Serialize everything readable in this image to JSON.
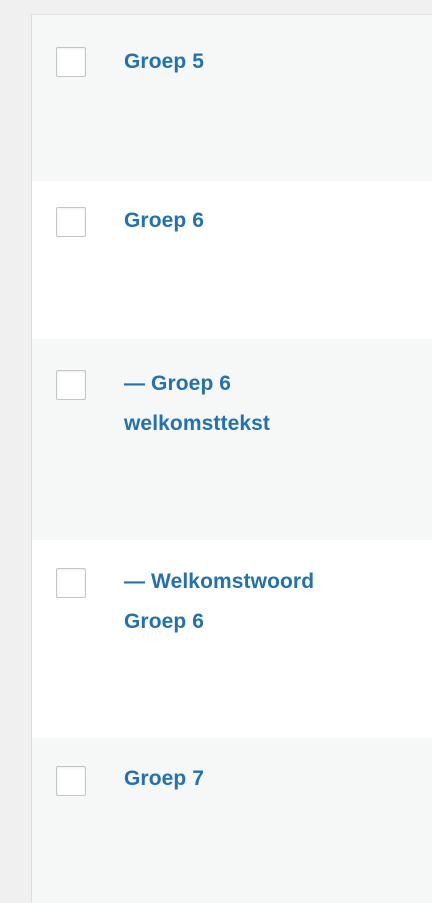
{
  "rows": [
    {
      "checkbox_checked": false,
      "title_lines": [
        "Groep 5"
      ]
    },
    {
      "checkbox_checked": false,
      "title_lines": [
        "Groep 6"
      ]
    },
    {
      "checkbox_checked": false,
      "title_lines": [
        "— Groep 6",
        "welkomsttekst"
      ]
    },
    {
      "checkbox_checked": false,
      "title_lines": [
        "— Welkomstwoord",
        "Groep 6"
      ]
    },
    {
      "checkbox_checked": false,
      "title_lines": [
        "Groep 7"
      ]
    }
  ],
  "colors": {
    "link": "#2271b1",
    "row_alt_bg": "#f6f7f7",
    "row_bg": "#ffffff",
    "page_bg": "#f0f0f1"
  }
}
